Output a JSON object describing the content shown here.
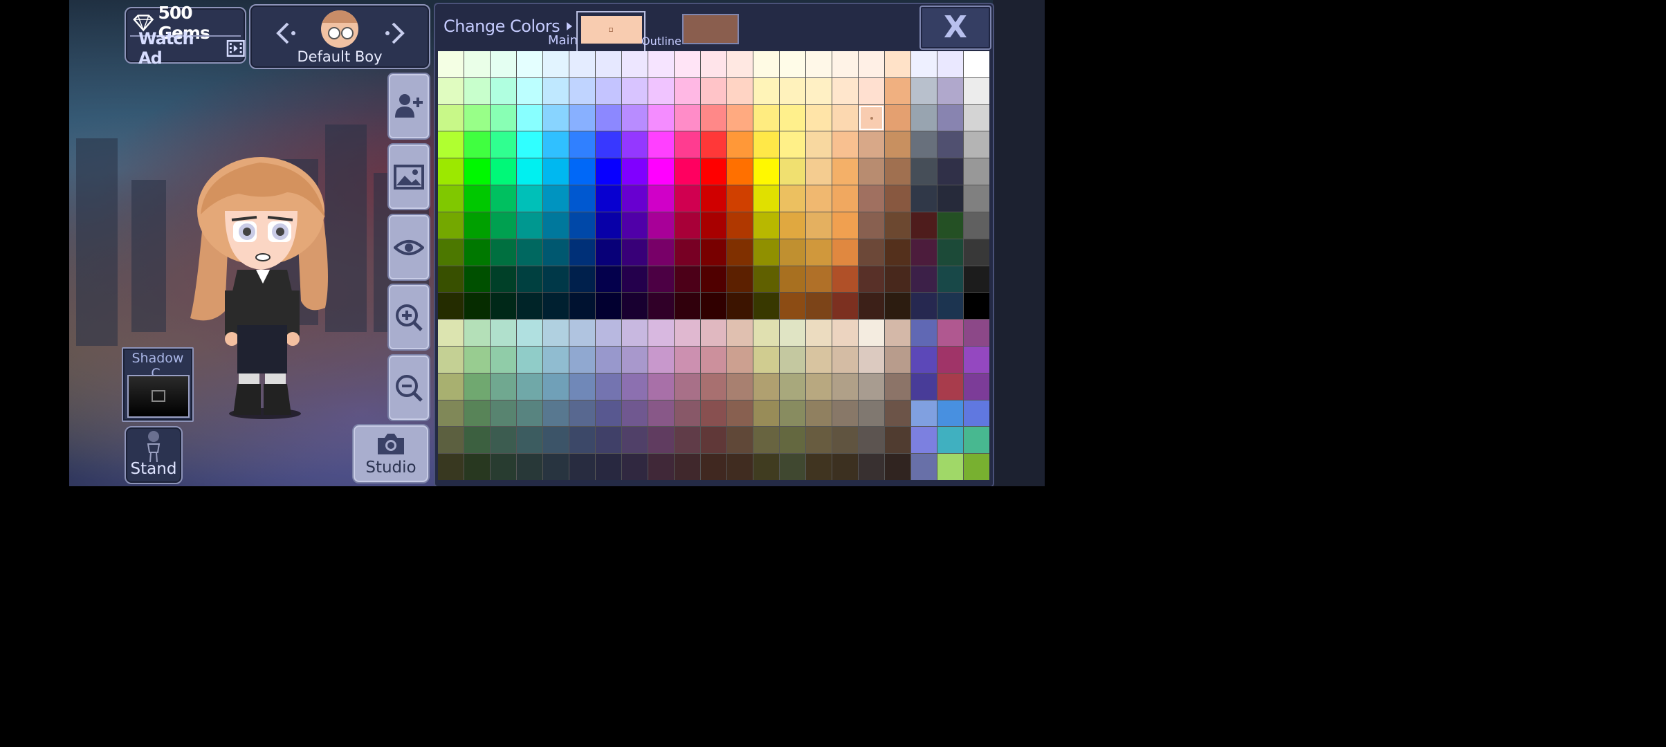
{
  "header": {
    "gems_label": "500 Gems",
    "watch_ad_label": "Watch Ad"
  },
  "character_selector": {
    "name": "Default Boy"
  },
  "side_buttons": [
    "add-character-icon",
    "background-image-icon",
    "eye-icon",
    "zoom-in-icon",
    "zoom-out-icon"
  ],
  "shadow": {
    "label": "Shadow C."
  },
  "stand": {
    "label": "Stand"
  },
  "studio": {
    "label": "Studio"
  },
  "color_panel": {
    "title": "Change Colors",
    "main_label": "Main",
    "outline_label": "Outline",
    "close_label": "X",
    "main_color": "#f8ccb0",
    "outline_color": "#8a5e4e",
    "selected": {
      "row": 2,
      "col": 16
    },
    "palette": [
      [
        "#f4ffe4",
        "#eaffe8",
        "#e4fff2",
        "#e4ffff",
        "#e2f4ff",
        "#e4ecff",
        "#e6e8ff",
        "#ede6ff",
        "#f6e4ff",
        "#ffe4f6",
        "#ffe4ea",
        "#ffe8e2",
        "#fffbe4",
        "#fffce8",
        "#fff8e8",
        "#fff3e7",
        "#fff0e6",
        "#ffe2c8",
        "#eef0ff",
        "#eae8ff",
        "#ffffff"
      ],
      [
        "#e0fcc0",
        "#c8ffcc",
        "#b0ffe0",
        "#bcffff",
        "#bfe8ff",
        "#c0d4ff",
        "#c4c4ff",
        "#d8c4ff",
        "#f0c4ff",
        "#ffb8e4",
        "#ffc4c8",
        "#ffd4c4",
        "#fff4b8",
        "#fff2bc",
        "#fff0c4",
        "#ffe6cc",
        "#ffe0d0",
        "#f0b080",
        "#b8c0cc",
        "#b0a8cc",
        "#ececec"
      ],
      [
        "#c8f888",
        "#98ff88",
        "#88ffb4",
        "#88ffff",
        "#88d4ff",
        "#88b0ff",
        "#8c88ff",
        "#b88cff",
        "#f48cff",
        "#ff8cc8",
        "#ff8888",
        "#ffaa80",
        "#ffec80",
        "#fff08c",
        "#ffe4a8",
        "#fcd8b0",
        "#f8ccb0",
        "#e4a070",
        "#98a4b0",
        "#8884b0",
        "#d4d4d4"
      ],
      [
        "#b0ff30",
        "#40ff40",
        "#30ff90",
        "#30ffff",
        "#30c0ff",
        "#3080ff",
        "#3838ff",
        "#9438ff",
        "#ff40ff",
        "#ff3c90",
        "#ff3838",
        "#ff9838",
        "#ffe848",
        "#fff088",
        "#f8d8a0",
        "#f8c090",
        "#d8a888",
        "#c89060",
        "#68707c",
        "#505070",
        "#b4b4b4"
      ],
      [
        "#9ce800",
        "#00f800",
        "#00f878",
        "#00f0f0",
        "#00b8f0",
        "#0068f8",
        "#0800ff",
        "#8000ff",
        "#ff00ff",
        "#ff0060",
        "#ff0000",
        "#ff7000",
        "#fff800",
        "#f0e070",
        "#f4cc90",
        "#f4b068",
        "#b88c70",
        "#a07050",
        "#464e58",
        "#303048",
        "#989898"
      ],
      [
        "#80c800",
        "#00c800",
        "#00c060",
        "#00c0b8",
        "#0094c0",
        "#0058d0",
        "#0800d0",
        "#6800d0",
        "#d000c8",
        "#d00050",
        "#d00000",
        "#d04000",
        "#e0e000",
        "#ecc060",
        "#f0b870",
        "#f0a860",
        "#a07060",
        "#885840",
        "#303848",
        "#262a3a",
        "#808080"
      ],
      [
        "#74a800",
        "#00a000",
        "#00a050",
        "#009890",
        "#00789c",
        "#0048a8",
        "#0800a8",
        "#5000a8",
        "#a80098",
        "#a80038",
        "#a80000",
        "#b03800",
        "#b8b800",
        "#e0a840",
        "#e4b060",
        "#f0a050",
        "#886050",
        "#6c4830",
        "#4e1c1c",
        "#245024",
        "#606060"
      ],
      [
        "#4c7800",
        "#007800",
        "#007040",
        "#006860",
        "#005870",
        "#003078",
        "#080078",
        "#380078",
        "#780068",
        "#780024",
        "#780000",
        "#803000",
        "#909000",
        "#c09030",
        "#d0983c",
        "#e08840",
        "#6c4838",
        "#54301c",
        "#4c1c3c",
        "#1c4a38",
        "#383838"
      ],
      [
        "#385000",
        "#005000",
        "#004028",
        "#004040",
        "#003848",
        "#00204c",
        "#04004c",
        "#24004c",
        "#4c0044",
        "#4c0018",
        "#500000",
        "#5c2000",
        "#606000",
        "#a87020",
        "#b07028",
        "#b05028",
        "#583028",
        "#48281c",
        "#3c2048",
        "#184848",
        "#1c1c1c"
      ],
      [
        "#242c00",
        "#062c00",
        "#002818",
        "#002428",
        "#002030",
        "#001230",
        "#020030",
        "#180030",
        "#300028",
        "#30000c",
        "#300000",
        "#3c1400",
        "#383800",
        "#8c4c14",
        "#7c4418",
        "#7c3020",
        "#3c2018",
        "#2c1c10",
        "#262850",
        "#1c3450",
        "#000000"
      ],
      [
        "#dce4b0",
        "#b4e0b8",
        "#b0e0cc",
        "#b0e0e0",
        "#b0d0e0",
        "#b0c4e0",
        "#b8b8e0",
        "#c8b8e0",
        "#d8b8e0",
        "#e0b8d0",
        "#e0b8c0",
        "#e0c0b0",
        "#e0e0b0",
        "#e0e4c4",
        "#ecdcc0",
        "#ecd4c0",
        "#f4ece0",
        "#d4b8a8",
        "#6068b4",
        "#b05890",
        "#8c4888"
      ],
      [
        "#c4d094",
        "#98cc90",
        "#90cca8",
        "#90ccc8",
        "#90bcd0",
        "#90a8d0",
        "#9898cc",
        "#a898cc",
        "#c898cc",
        "#cc90b0",
        "#cc909c",
        "#cca090",
        "#d0cc90",
        "#c4c8a0",
        "#d8c4a0",
        "#d4bca4",
        "#dccac0",
        "#b89c8c",
        "#5c48b8",
        "#a03468",
        "#9448c0"
      ],
      [
        "#a8b070",
        "#70a870",
        "#70a890",
        "#70a8a8",
        "#70a0b8",
        "#7088b8",
        "#7474b0",
        "#8c70b0",
        "#a870a8",
        "#a87088",
        "#a87070",
        "#a88070",
        "#b0a070",
        "#a8a87c",
        "#b8a880",
        "#b0a088",
        "#a89c90",
        "#8c7468",
        "#483c98",
        "#a83c4c",
        "#7c3c98"
      ],
      [
        "#808858",
        "#588458",
        "#588470",
        "#588480",
        "#587890",
        "#586890",
        "#585890",
        "#705890",
        "#885888",
        "#885868",
        "#885050",
        "#886050",
        "#988c58",
        "#888c60",
        "#908060",
        "#887868",
        "#807870",
        "#6c5448",
        "#80a0e0",
        "#4890e0",
        "#6078e0"
      ],
      [
        "#5c6040",
        "#3c6040",
        "#3c5c50",
        "#3c5c60",
        "#3c5468",
        "#3c4868",
        "#404068",
        "#504068",
        "#603c60",
        "#603c48",
        "#603838",
        "#604838",
        "#686440",
        "#646840",
        "#685c40",
        "#605440",
        "#5c5450",
        "#503c30",
        "#7c80e0",
        "#40b0c0",
        "#48b890"
      ],
      [
        "#383820",
        "#283820",
        "#283c30",
        "#283838",
        "#283440",
        "#282c40",
        "#282840",
        "#302840",
        "#402838",
        "#40282c",
        "#402820",
        "#402c20",
        "#403c20",
        "#404830",
        "#403420",
        "#3c3020",
        "#383030",
        "#302420",
        "#6870a8",
        "#a0d868",
        "#78b030"
      ]
    ]
  }
}
